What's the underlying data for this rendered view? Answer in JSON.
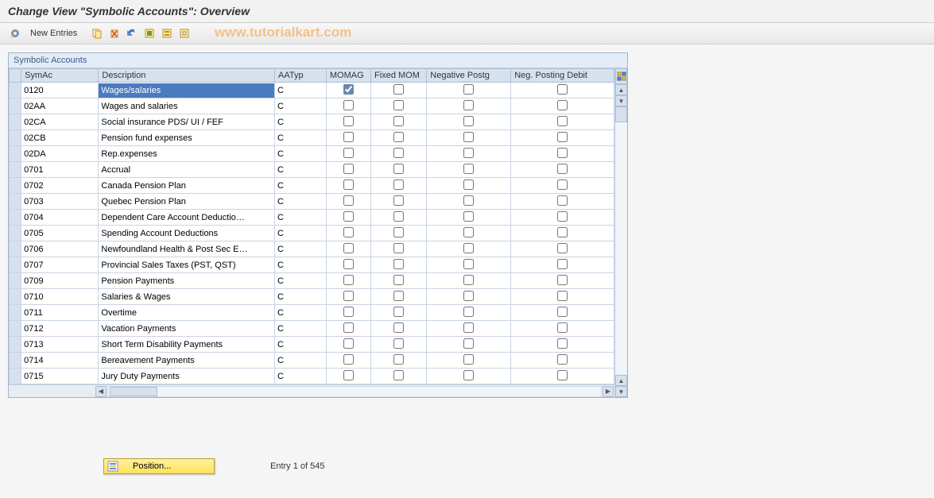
{
  "header": {
    "title": "Change View \"Symbolic Accounts\": Overview"
  },
  "watermark": "www.tutorialkart.com",
  "toolbar": {
    "new_entries": "New Entries"
  },
  "panel": {
    "title": "Symbolic Accounts"
  },
  "columns": {
    "symac": "SymAc",
    "description": "Description",
    "aatyp": "AATyp",
    "momag": "MOMAG",
    "fixed_mom": "Fixed MOM",
    "neg_postg": "Negative Postg",
    "neg_debit": "Neg. Posting Debit"
  },
  "rows": [
    {
      "symac": "0120",
      "desc": "Wages/salaries",
      "aatyp": "C",
      "momag": true,
      "fmom": false,
      "negp": false,
      "negd": false,
      "selected": true
    },
    {
      "symac": "02AA",
      "desc": "Wages and salaries",
      "aatyp": "C",
      "momag": false,
      "fmom": false,
      "negp": false,
      "negd": false
    },
    {
      "symac": "02CA",
      "desc": "Social insurance PDS/ UI / FEF",
      "aatyp": "C",
      "momag": false,
      "fmom": false,
      "negp": false,
      "negd": false
    },
    {
      "symac": "02CB",
      "desc": "Pension fund expenses",
      "aatyp": "C",
      "momag": false,
      "fmom": false,
      "negp": false,
      "negd": false
    },
    {
      "symac": "02DA",
      "desc": "Rep.expenses",
      "aatyp": "C",
      "momag": false,
      "fmom": false,
      "negp": false,
      "negd": false
    },
    {
      "symac": "0701",
      "desc": "Accrual",
      "aatyp": "C",
      "momag": false,
      "fmom": false,
      "negp": false,
      "negd": false
    },
    {
      "symac": "0702",
      "desc": "Canada Pension Plan",
      "aatyp": "C",
      "momag": false,
      "fmom": false,
      "negp": false,
      "negd": false
    },
    {
      "symac": "0703",
      "desc": "Quebec Pension Plan",
      "aatyp": "C",
      "momag": false,
      "fmom": false,
      "negp": false,
      "negd": false
    },
    {
      "symac": "0704",
      "desc": "Dependent Care Account Deductio…",
      "aatyp": "C",
      "momag": false,
      "fmom": false,
      "negp": false,
      "negd": false
    },
    {
      "symac": "0705",
      "desc": "Spending Account Deductions",
      "aatyp": "C",
      "momag": false,
      "fmom": false,
      "negp": false,
      "negd": false
    },
    {
      "symac": "0706",
      "desc": "Newfoundland Health & Post Sec E…",
      "aatyp": "C",
      "momag": false,
      "fmom": false,
      "negp": false,
      "negd": false
    },
    {
      "symac": "0707",
      "desc": "Provincial Sales Taxes (PST, QST)",
      "aatyp": "C",
      "momag": false,
      "fmom": false,
      "negp": false,
      "negd": false
    },
    {
      "symac": "0709",
      "desc": "Pension Payments",
      "aatyp": "C",
      "momag": false,
      "fmom": false,
      "negp": false,
      "negd": false
    },
    {
      "symac": "0710",
      "desc": "Salaries & Wages",
      "aatyp": "C",
      "momag": false,
      "fmom": false,
      "negp": false,
      "negd": false
    },
    {
      "symac": "0711",
      "desc": "Overtime",
      "aatyp": "C",
      "momag": false,
      "fmom": false,
      "negp": false,
      "negd": false
    },
    {
      "symac": "0712",
      "desc": "Vacation Payments",
      "aatyp": "C",
      "momag": false,
      "fmom": false,
      "negp": false,
      "negd": false
    },
    {
      "symac": "0713",
      "desc": "Short Term Disability Payments",
      "aatyp": "C",
      "momag": false,
      "fmom": false,
      "negp": false,
      "negd": false
    },
    {
      "symac": "0714",
      "desc": "Bereavement Payments",
      "aatyp": "C",
      "momag": false,
      "fmom": false,
      "negp": false,
      "negd": false
    },
    {
      "symac": "0715",
      "desc": "Jury Duty Payments",
      "aatyp": "C",
      "momag": false,
      "fmom": false,
      "negp": false,
      "negd": false
    }
  ],
  "footer": {
    "position_label": "Position...",
    "entry_info": "Entry 1 of 545"
  }
}
